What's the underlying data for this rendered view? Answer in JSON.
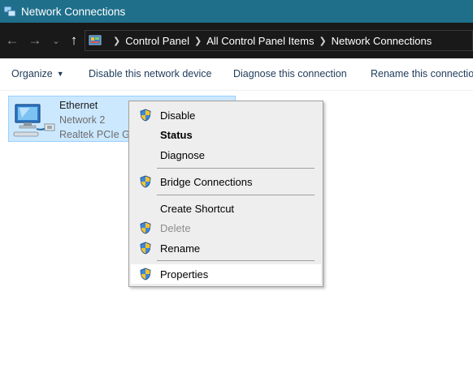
{
  "window": {
    "title": "Network Connections"
  },
  "nav": {
    "back_icon": "arrow-left-icon",
    "forward_icon": "arrow-right-icon",
    "recent_icon": "chevron-down-icon",
    "up_icon": "arrow-up-icon"
  },
  "breadcrumbs": [
    "Control Panel",
    "All Control Panel Items",
    "Network Connections"
  ],
  "toolbar": {
    "organize": "Organize",
    "disable": "Disable this network device",
    "diagnose": "Diagnose this connection",
    "rename": "Rename this connection"
  },
  "adapter": {
    "name": "Ethernet",
    "network": "Network 2",
    "device": "Realtek PCIe GbE Family Controller"
  },
  "context_menu": {
    "items": [
      {
        "label": "Disable",
        "shield": true
      },
      {
        "label": "Status",
        "bold": true
      },
      {
        "label": "Diagnose"
      },
      {
        "label": "Bridge Connections",
        "shield": true
      },
      {
        "label": "Create Shortcut"
      },
      {
        "label": "Delete",
        "shield": true,
        "disabled": true
      },
      {
        "label": "Rename",
        "shield": true
      },
      {
        "label": "Properties",
        "shield": true,
        "highlighted": true
      }
    ]
  },
  "colors": {
    "titlebar": "#1f6f8b",
    "navbar": "#191919",
    "selection": "#cce8ff",
    "menu_bg": "#eeeeee"
  }
}
